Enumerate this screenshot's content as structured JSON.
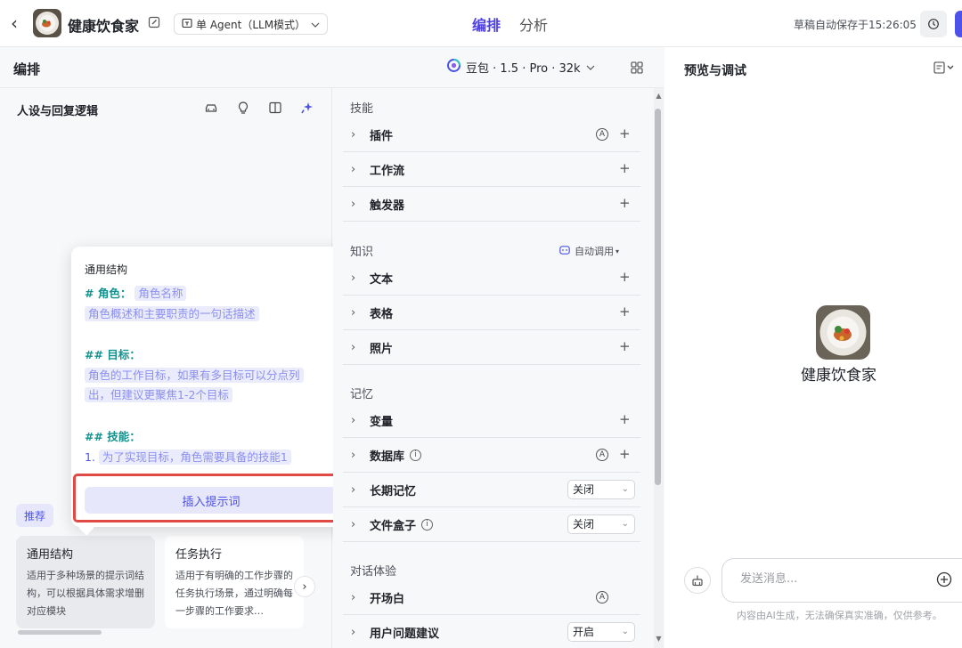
{
  "header": {
    "back_icon": "chevron-left-icon",
    "app_name": "健康饮食家",
    "mode_label": "单 Agent（LLM模式）",
    "tabs": [
      {
        "label": "编排"
      },
      {
        "label": "分析"
      }
    ],
    "autosave": "草稿自动保存于15:26:05"
  },
  "edit": {
    "title": "编排",
    "model": "豆包 · 1.5 · Pro · 32k"
  },
  "persona": {
    "title": "人设与回复逻辑",
    "popover": {
      "title": "通用结构",
      "role_h": "# 角色：",
      "role_name": "角色名称",
      "role_desc": "角色概述和主要职责的一句话描述",
      "goal_h": "## 目标：",
      "goal_1": "角色的工作目标，如果有多目标可以分点列",
      "goal_2": "出，但建议更聚焦1-2个目标",
      "skill_h": "## 技能：",
      "skill_num": "1.",
      "skill_1": "为了实现目标，角色需要具备的技能1",
      "insert_label": "插入提示词"
    },
    "recommend_label": "推荐",
    "cards": [
      {
        "title": "通用结构",
        "desc": "适用于多种场景的提示词结构，可以根据具体需求增删对应模块"
      },
      {
        "title": "任务执行",
        "desc": "适用于有明确的工作步骤的任务执行场景，通过明确每一步骤的工作要求…"
      }
    ]
  },
  "skills": {
    "section_skill": "技能",
    "section_knowledge": "知识",
    "section_memory": "记忆",
    "section_dialog": "对话体验",
    "auto_call": "自动调用",
    "plugin": "插件",
    "workflow": "工作流",
    "trigger": "触发器",
    "text": "文本",
    "table": "表格",
    "photo": "照片",
    "variable": "变量",
    "database": "数据库",
    "long_memory": "长期记忆",
    "long_memory_value": "关闭",
    "file_box": "文件盒子",
    "file_box_value": "关闭",
    "opener": "开场白",
    "suggestion": "用户问题建议",
    "suggestion_value": "开启"
  },
  "preview": {
    "title": "预览与调试",
    "bot_name": "健康饮食家",
    "input_placeholder": "发送消息...",
    "disclaimer": "内容由AI生成，无法确保真实准确，仅供参考。"
  },
  "colors": {
    "accent": "#4d53e8",
    "tab_active": "#4e40e5",
    "heading_teal": "#13928e",
    "highlight_red": "#e04a45"
  }
}
